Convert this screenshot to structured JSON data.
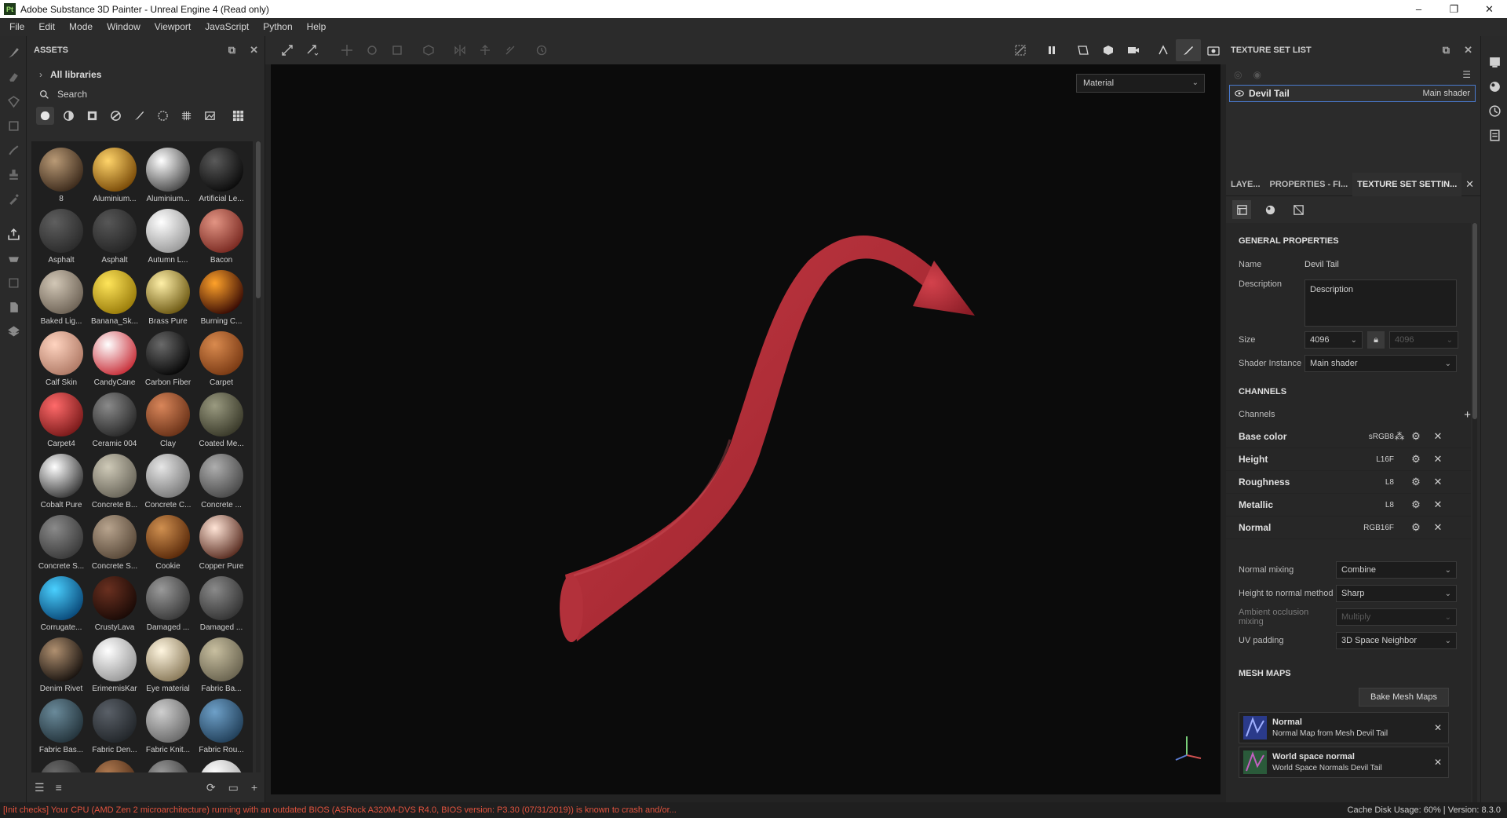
{
  "window": {
    "app_badge": "Pt",
    "title": "Adobe Substance 3D Painter - Unreal Engine 4 (Read only)",
    "controls": [
      "–",
      "❐",
      "✕"
    ]
  },
  "menu": [
    "File",
    "Edit",
    "Mode",
    "Window",
    "Viewport",
    "JavaScript",
    "Python",
    "Help"
  ],
  "assets": {
    "title": "ASSETS",
    "library": "All libraries",
    "search_placeholder": "Search",
    "items": [
      {
        "label": "8",
        "c1": "#b99a76",
        "c2": "#3d2b1c"
      },
      {
        "label": "Aluminium...",
        "c1": "#ffd46a",
        "c2": "#7a4b08"
      },
      {
        "label": "Aluminium...",
        "c1": "#ffffff",
        "c2": "#4a4a4a"
      },
      {
        "label": "Artificial Le...",
        "c1": "#5a5a5a",
        "c2": "#0b0b0b"
      },
      {
        "label": "Asphalt",
        "c1": "#5f5f5f",
        "c2": "#2b2b2b"
      },
      {
        "label": "Asphalt",
        "c1": "#575757",
        "c2": "#262626"
      },
      {
        "label": "Autumn L...",
        "c1": "#ffffff",
        "c2": "#9a9a9a"
      },
      {
        "label": "Bacon",
        "c1": "#e29483",
        "c2": "#7a2a22"
      },
      {
        "label": "Baked Lig...",
        "c1": "#d2c7b6",
        "c2": "#6e6356"
      },
      {
        "label": "Banana_Sk...",
        "c1": "#ffe55a",
        "c2": "#9a7c0a"
      },
      {
        "label": "Brass Pure",
        "c1": "#fff0a8",
        "c2": "#6e5a14"
      },
      {
        "label": "Burning C...",
        "c1": "#ffa22a",
        "c2": "#3a0c04"
      },
      {
        "label": "Calf Skin",
        "c1": "#ffd4c0",
        "c2": "#b07a66"
      },
      {
        "label": "CandyCane",
        "c1": "#ffffff",
        "c2": "#c8303a"
      },
      {
        "label": "Carbon Fiber",
        "c1": "#6a6a6a",
        "c2": "#070707"
      },
      {
        "label": "Carpet",
        "c1": "#d98a4e",
        "c2": "#7a3a14"
      },
      {
        "label": "Carpet4",
        "c1": "#ff6a6a",
        "c2": "#7a1a1a"
      },
      {
        "label": "Ceramic 004",
        "c1": "#8a8a8a",
        "c2": "#2a2a2a"
      },
      {
        "label": "Clay",
        "c1": "#d9865a",
        "c2": "#6a3218"
      },
      {
        "label": "Coated Me...",
        "c1": "#9a9a80",
        "c2": "#3a3a2a"
      },
      {
        "label": "Cobalt Pure",
        "c1": "#ffffff",
        "c2": "#3a3a3a"
      },
      {
        "label": "Concrete B...",
        "c1": "#cfcab8",
        "c2": "#6a665a"
      },
      {
        "label": "Concrete C...",
        "c1": "#e6e6e6",
        "c2": "#7a7a7a"
      },
      {
        "label": "Concrete ...",
        "c1": "#aeaeae",
        "c2": "#4a4a4a"
      },
      {
        "label": "Concrete S...",
        "c1": "#8a8a8a",
        "c2": "#3a3a3a"
      },
      {
        "label": "Concrete S...",
        "c1": "#b8a48e",
        "c2": "#5a4a3a"
      },
      {
        "label": "Cookie",
        "c1": "#d09050",
        "c2": "#5a2a0a"
      },
      {
        "label": "Copper Pure",
        "c1": "#ffe4d6",
        "c2": "#5a2e22"
      },
      {
        "label": "Corrugate...",
        "c1": "#4ad0ff",
        "c2": "#0a4a7a"
      },
      {
        "label": "CrustyLava",
        "c1": "#6a3020",
        "c2": "#1a0a06"
      },
      {
        "label": "Damaged ...",
        "c1": "#9a9a9a",
        "c2": "#3a3a3a"
      },
      {
        "label": "Damaged ...",
        "c1": "#8a8a8a",
        "c2": "#343434"
      },
      {
        "label": "Denim Rivet",
        "c1": "#b09070",
        "c2": "#1a1410"
      },
      {
        "label": "ErimemisKar",
        "c1": "#ffffff",
        "c2": "#9a9a9a"
      },
      {
        "label": "Eye material",
        "c1": "#fff6e0",
        "c2": "#8a7a5a"
      },
      {
        "label": "Fabric Ba...",
        "c1": "#c8bfa0",
        "c2": "#6a6450"
      },
      {
        "label": "Fabric Bas...",
        "c1": "#6a8a9a",
        "c2": "#24343c"
      },
      {
        "label": "Fabric Den...",
        "c1": "#5a6068",
        "c2": "#22262a"
      },
      {
        "label": "Fabric Knit...",
        "c1": "#cfcfcf",
        "c2": "#6a6a6a"
      },
      {
        "label": "Fabric Rou...",
        "c1": "#6ea0c8",
        "c2": "#22405a"
      },
      {
        "label": "",
        "c1": "#6a6a6a",
        "c2": "#2a2a2a"
      },
      {
        "label": "",
        "c1": "#b07a50",
        "c2": "#4a2a16"
      },
      {
        "label": "",
        "c1": "#9a9a9a",
        "c2": "#3a3a3a"
      },
      {
        "label": "",
        "c1": "#ffffff",
        "c2": "#aaaaaa"
      }
    ]
  },
  "viewport": {
    "channel_select": "Material"
  },
  "texture_set_list": {
    "title": "TEXTURE SET LIST",
    "set_name": "Devil Tail",
    "shader": "Main shader"
  },
  "tabs": [
    "LAYE...",
    "PROPERTIES - FI...",
    "TEXTURE SET SETTIN..."
  ],
  "general": {
    "title": "GENERAL PROPERTIES",
    "name_label": "Name",
    "name_value": "Devil Tail",
    "desc_label": "Description",
    "desc_value": "Description",
    "size_label": "Size",
    "size_value": "4096",
    "size_value2": "4096",
    "shader_label": "Shader Instance",
    "shader_value": "Main shader"
  },
  "channels": {
    "title": "CHANNELS",
    "header": "Channels",
    "items": [
      {
        "name": "Base color",
        "fmt": "sRGB8"
      },
      {
        "name": "Height",
        "fmt": "L16F"
      },
      {
        "name": "Roughness",
        "fmt": "L8"
      },
      {
        "name": "Metallic",
        "fmt": "L8"
      },
      {
        "name": "Normal",
        "fmt": "RGB16F"
      }
    ]
  },
  "mixing": {
    "normal_label": "Normal mixing",
    "normal_value": "Combine",
    "h2n_label": "Height to normal method",
    "h2n_value": "Sharp",
    "ao_label": "Ambient occlusion mixing",
    "ao_value": "Multiply",
    "uv_label": "UV padding",
    "uv_value": "3D Space Neighbor"
  },
  "mesh_maps": {
    "title": "MESH MAPS",
    "bake_label": "Bake Mesh Maps",
    "items": [
      {
        "title": "Normal",
        "sub": "Normal Map from Mesh Devil Tail"
      },
      {
        "title": "World space normal",
        "sub": "World Space Normals Devil Tail"
      }
    ]
  },
  "status": {
    "error": "[Init checks] Your CPU (AMD Zen 2 microarchitecture) running with an outdated BIOS (ASRock A320M-DVS R4.0, BIOS version: P3.30 (07/31/2019)) is known to crash and/or...",
    "right": "Cache Disk Usage:   60%  |  Version: 8.3.0"
  },
  "colors": {
    "accent": "#4a7bd0",
    "error": "#e2533e",
    "tail": "#b8323a"
  }
}
